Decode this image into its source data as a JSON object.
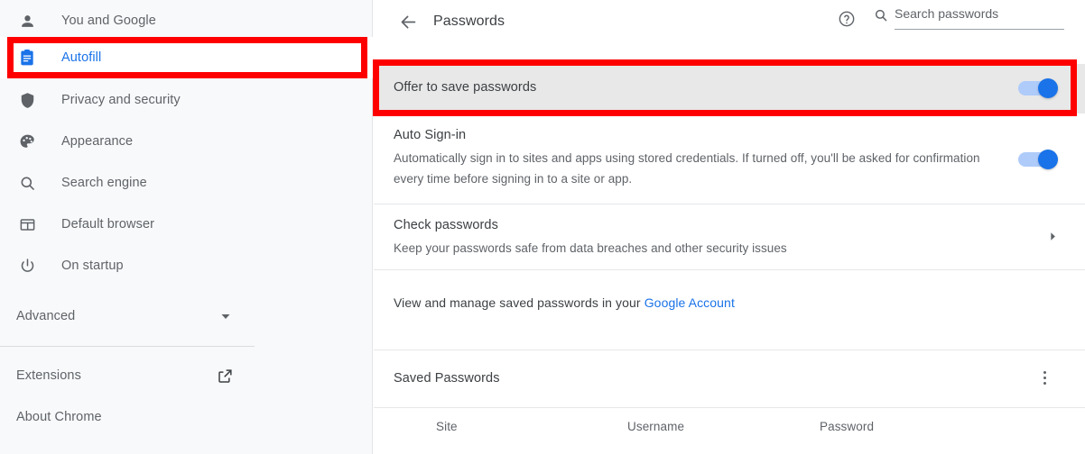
{
  "sidebar": {
    "items": [
      {
        "label": "You and Google",
        "icon": "person-icon",
        "selected": false
      },
      {
        "label": "Autofill",
        "icon": "clipboard-icon",
        "selected": true
      },
      {
        "label": "Privacy and security",
        "icon": "shield-icon",
        "selected": false
      },
      {
        "label": "Appearance",
        "icon": "palette-icon",
        "selected": false
      },
      {
        "label": "Search engine",
        "icon": "magnifier-icon",
        "selected": false
      },
      {
        "label": "Default browser",
        "icon": "browser-window-icon",
        "selected": false
      },
      {
        "label": "On startup",
        "icon": "power-icon",
        "selected": false
      }
    ],
    "advanced": {
      "label": "Advanced",
      "icon": "chevron-down-icon"
    },
    "extensions": {
      "label": "Extensions",
      "icon": "external-link-icon"
    },
    "about": {
      "label": "About Chrome"
    }
  },
  "header": {
    "back_icon": "arrow-left-icon",
    "title": "Passwords",
    "help_icon": "help-circle-icon",
    "search_icon": "search-icon",
    "search_placeholder": "Search passwords",
    "search_value": ""
  },
  "settings": {
    "offer_to_save": {
      "title": "Offer to save passwords",
      "toggle_state": "on"
    },
    "auto_signin": {
      "title": "Auto Sign-in",
      "description": "Automatically sign in to sites and apps using stored credentials. If turned off, you'll be asked for confirmation every time before signing in to a site or app.",
      "toggle_state": "on"
    },
    "check_passwords": {
      "title": "Check passwords",
      "description": "Keep your passwords safe from data breaches and other security issues",
      "chevron_icon": "chevron-right-icon"
    },
    "google_account": {
      "prefix": "View and manage saved passwords in your ",
      "link_label": "Google Account"
    }
  },
  "saved_passwords": {
    "title": "Saved Passwords",
    "menu_icon": "more-vert-icon",
    "columns": [
      "Site",
      "Username",
      "Password"
    ],
    "rows": []
  },
  "colors": {
    "accent": "#1a73e8",
    "toggle_track": "#aecbfa",
    "annotation": "#fe0000",
    "sidebar_bg": "#f8f9fa",
    "highlight_row": "#e8e8e8"
  }
}
